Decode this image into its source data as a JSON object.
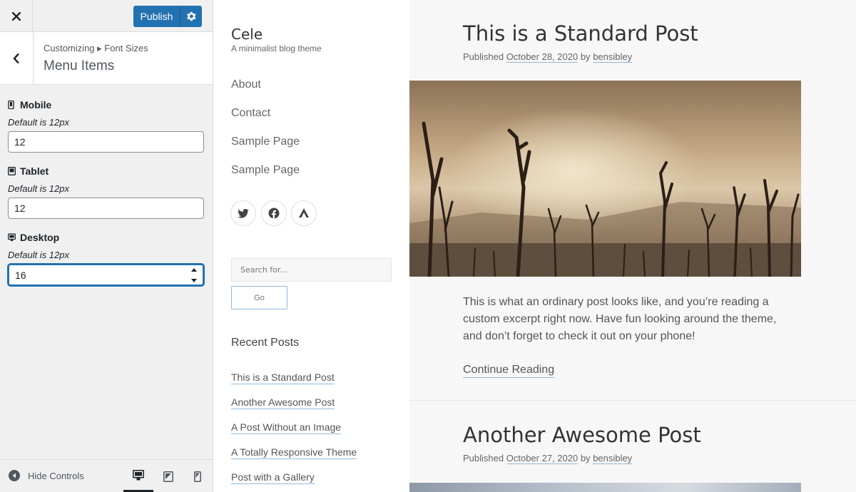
{
  "customizer": {
    "publish_label": "Publish",
    "breadcrumb": "Customizing ▸ Font Sizes",
    "section_title": "Menu Items",
    "controls": [
      {
        "label": "Mobile",
        "description": "Default is 12px",
        "value": "12",
        "icon": "smartphone-icon"
      },
      {
        "label": "Tablet",
        "description": "Default is 12px",
        "value": "12",
        "icon": "tablet-icon"
      },
      {
        "label": "Desktop",
        "description": "Default is 12px",
        "value": "16",
        "icon": "desktop-icon"
      }
    ],
    "hide_controls_label": "Hide Controls",
    "active_device": "desktop",
    "accent_color": "#2271b1"
  },
  "site": {
    "title": "Cele",
    "tagline": "A minimalist blog theme",
    "menu": [
      "About",
      "Contact",
      "Sample Page",
      "Sample Page"
    ],
    "social": [
      "twitter-icon",
      "facebook-icon",
      "strava-icon"
    ],
    "search_placeholder": "Search for...",
    "search_button": "Go",
    "recent_title": "Recent Posts",
    "recent_posts": [
      "This is a Standard Post",
      "Another Awesome Post",
      "A Post Without an Image",
      "A Totally Responsive Theme",
      "Post with a Gallery"
    ]
  },
  "posts": [
    {
      "title": "This is a Standard Post",
      "published_label": "Published",
      "date": "October 28, 2020",
      "by_label": "by",
      "author": "bensibley",
      "excerpt": "This is what an ordinary post looks like, and you’re reading a custom excerpt right now. Have fun looking around the theme, and don’t forget to check it out on your phone!",
      "more_label": "Continue Reading"
    },
    {
      "title": "Another Awesome Post",
      "published_label": "Published",
      "date": "October 27, 2020",
      "by_label": "by",
      "author": "bensibley"
    }
  ]
}
